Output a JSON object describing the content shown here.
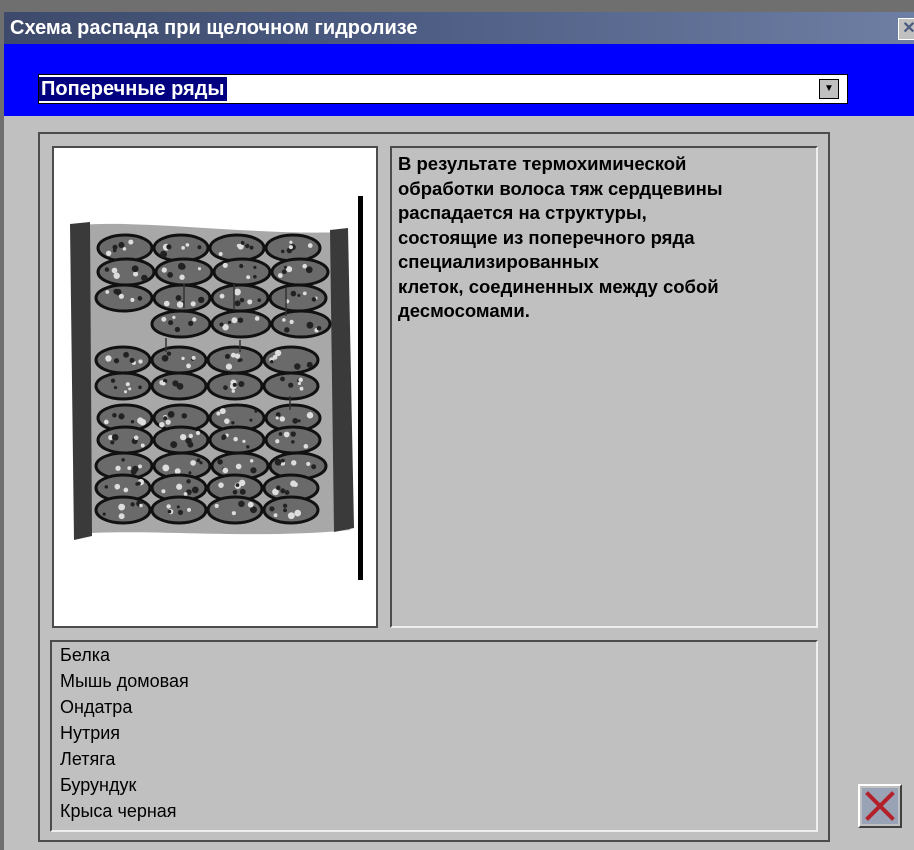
{
  "window": {
    "title": "Схема распада при щелочном гидролизе",
    "title_close_icon": "close-icon"
  },
  "combo": {
    "selected": "Поперечные ряды",
    "arrow_icon": "chevron-down-icon"
  },
  "description": {
    "text": "В результате термохимической\nобработки волоса тяж сердцевины\nраспадается на структуры,\nсостоящие из поперечного ряда\nспециализированных\nклеток, соединенных между собой\nдесмосомами."
  },
  "image": {
    "icon": "medulla-cell-rows-illustration"
  },
  "species_list": {
    "items": [
      "Белка",
      "Мышь домовая",
      "Ондатра",
      "Нутрия",
      "Летяга",
      "Бурундук",
      "Крыса черная"
    ]
  },
  "close_button": {
    "icon": "close-x-icon"
  },
  "colors": {
    "title_bar": "#4a5a80",
    "band": "#0000ff",
    "selection": "#000080",
    "face": "#c0c0c0",
    "close_x": "#b3202a"
  }
}
